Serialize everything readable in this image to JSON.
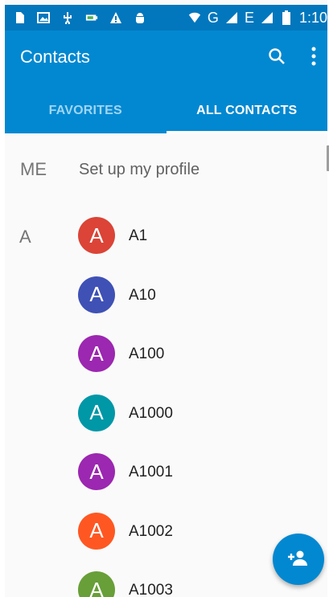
{
  "status_bar": {
    "time": "1:10",
    "network": "G",
    "network2": "E"
  },
  "toolbar": {
    "title": "Contacts",
    "search_icon": "search-icon",
    "overflow_icon": "more-vert-icon"
  },
  "tabs": [
    {
      "label": "FAVORITES",
      "active": false
    },
    {
      "label": "ALL CONTACTS",
      "active": true
    }
  ],
  "me_section": {
    "label": "ME",
    "text": "Set up my profile"
  },
  "section_letter": "A",
  "contacts": [
    {
      "name": "A1",
      "initial": "A",
      "color": "#db4437"
    },
    {
      "name": "A10",
      "initial": "A",
      "color": "#3f51b5"
    },
    {
      "name": "A100",
      "initial": "A",
      "color": "#9c27b0"
    },
    {
      "name": "A1000",
      "initial": "A",
      "color": "#0097a7"
    },
    {
      "name": "A1001",
      "initial": "A",
      "color": "#9c27b0"
    },
    {
      "name": "A1002",
      "initial": "A",
      "color": "#ff5722"
    },
    {
      "name": "A1003",
      "initial": "A",
      "color": "#689f38"
    }
  ],
  "fab": {
    "icon": "add-person-icon"
  },
  "colors": {
    "primary": "#0288d1",
    "primary_dark": "#0277bd",
    "tab_inactive": "#9fd6f3"
  }
}
